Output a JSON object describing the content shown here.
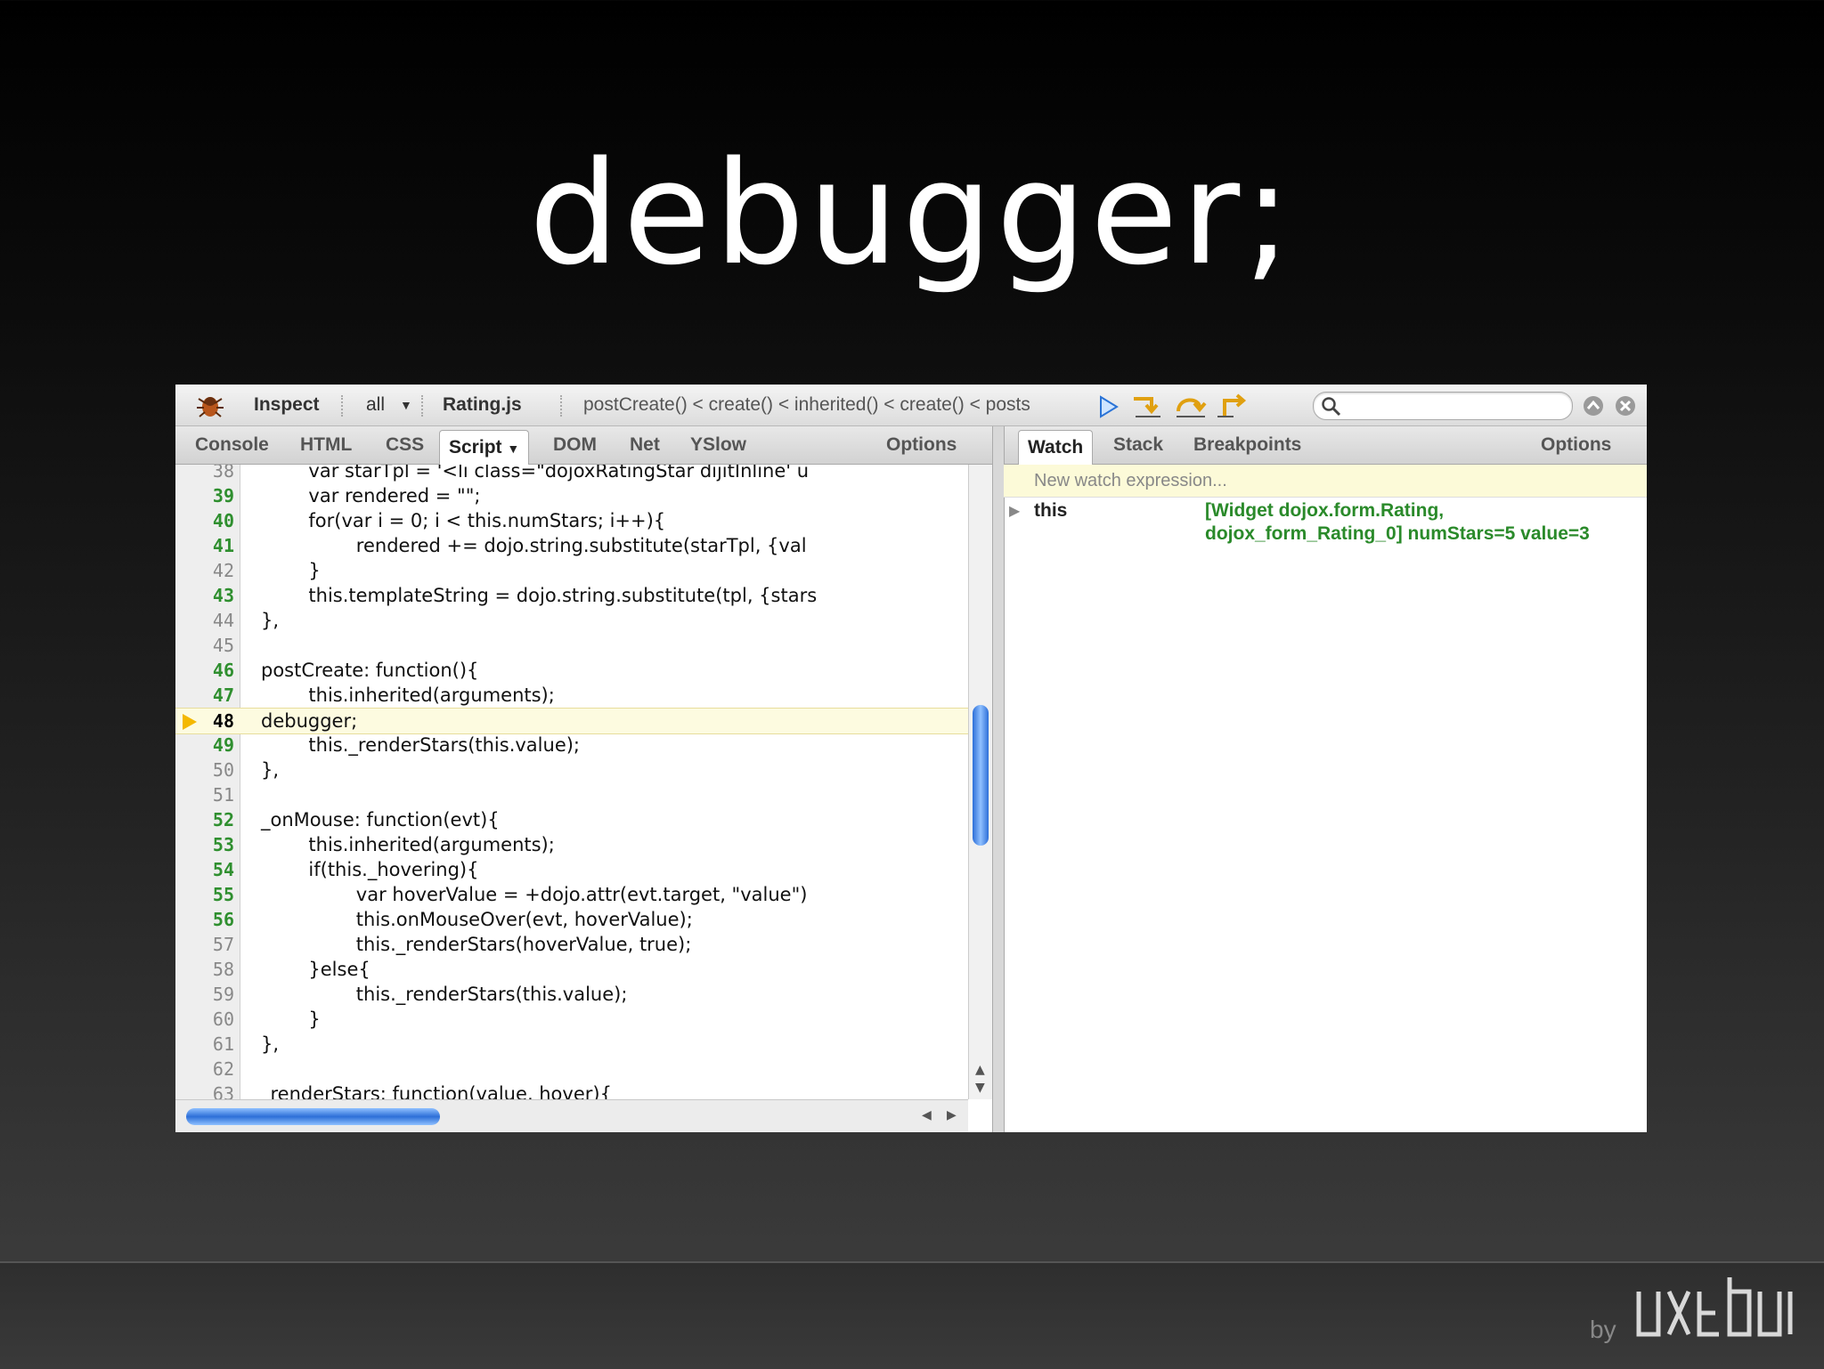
{
  "slide": {
    "title": "debugger;"
  },
  "toolbar": {
    "inspect_label": "Inspect",
    "filter_value": "all",
    "file_label": "Rating.js",
    "call_stack": "postCreate() < create() < inherited() < create() < posts",
    "search_placeholder": ""
  },
  "left_tabs": [
    "Console",
    "HTML",
    "CSS",
    "Script",
    "DOM",
    "Net",
    "YSlow"
  ],
  "left_options_label": "Options",
  "right_tabs": [
    "Watch",
    "Stack",
    "Breakpoints"
  ],
  "right_options_label": "Options",
  "code": {
    "current_line": "48",
    "lines": [
      {
        "n": "38",
        "text": "        var starTpl = '<li class=\"dojoxRatingStar dijitInline' u",
        "dim": true
      },
      {
        "n": "39",
        "text": "        var rendered = \"\";",
        "dim": false
      },
      {
        "n": "40",
        "text": "        for(var i = 0; i < this.numStars; i++){",
        "dim": false
      },
      {
        "n": "41",
        "text": "                rendered += dojo.string.substitute(starTpl, {val",
        "dim": false
      },
      {
        "n": "42",
        "text": "        }",
        "dim": true
      },
      {
        "n": "43",
        "text": "        this.templateString = dojo.string.substitute(tpl, {stars",
        "dim": false
      },
      {
        "n": "44",
        "text": "},",
        "dim": true
      },
      {
        "n": "45",
        "text": "",
        "dim": true
      },
      {
        "n": "46",
        "text": "postCreate: function(){",
        "dim": false
      },
      {
        "n": "47",
        "text": "        this.inherited(arguments);",
        "dim": false
      },
      {
        "n": "48",
        "text": "debugger;",
        "dim": false
      },
      {
        "n": "49",
        "text": "        this._renderStars(this.value);",
        "dim": false
      },
      {
        "n": "50",
        "text": "},",
        "dim": true
      },
      {
        "n": "51",
        "text": "",
        "dim": true
      },
      {
        "n": "52",
        "text": "_onMouse: function(evt){",
        "dim": false
      },
      {
        "n": "53",
        "text": "        this.inherited(arguments);",
        "dim": false
      },
      {
        "n": "54",
        "text": "        if(this._hovering){",
        "dim": false
      },
      {
        "n": "55",
        "text": "                var hoverValue = +dojo.attr(evt.target, \"value\")",
        "dim": false
      },
      {
        "n": "56",
        "text": "                this.onMouseOver(evt, hoverValue);",
        "dim": false
      },
      {
        "n": "57",
        "text": "                this._renderStars(hoverValue, true);",
        "dim": true
      },
      {
        "n": "58",
        "text": "        }else{",
        "dim": true
      },
      {
        "n": "59",
        "text": "                this._renderStars(this.value);",
        "dim": true
      },
      {
        "n": "60",
        "text": "        }",
        "dim": true
      },
      {
        "n": "61",
        "text": "},",
        "dim": true
      },
      {
        "n": "62",
        "text": "",
        "dim": true
      },
      {
        "n": "63",
        "text": "_renderStars: function(value, hover){",
        "dim": true
      }
    ]
  },
  "watch": {
    "new_expression_placeholder": "New watch expression...",
    "entry_name": "this",
    "entry_value_line1": "[Widget dojox.form.Rating,",
    "entry_value_line2": "dojox_form_Rating_0] numStars=5 value=3"
  },
  "footer": {
    "by_label": "by",
    "logo_text": "uxebu"
  },
  "colors": {
    "line_number": "#2f8f2f",
    "watch_value": "#2a8a2a",
    "current_line_bg": "#fdfbe0"
  }
}
